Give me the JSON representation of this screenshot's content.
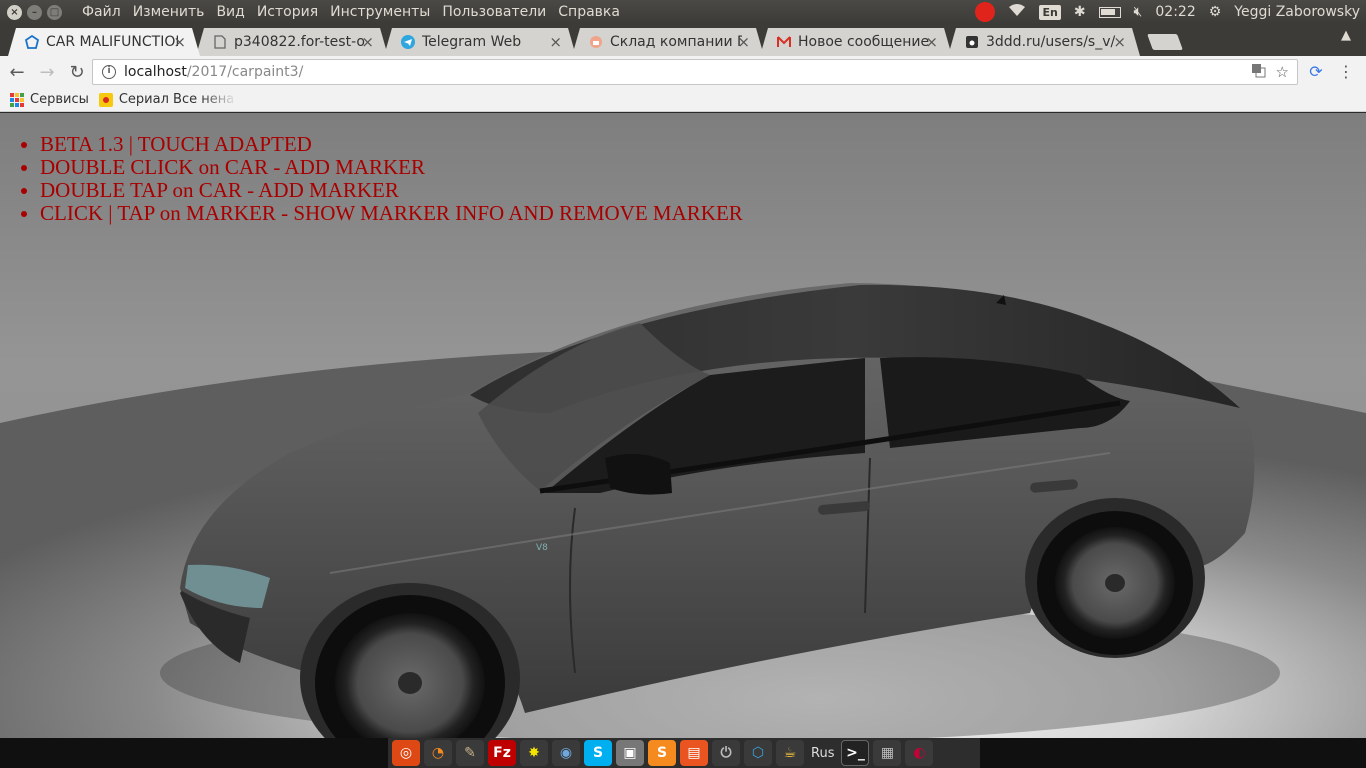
{
  "system_panel": {
    "menu": [
      "Файл",
      "Изменить",
      "Вид",
      "История",
      "Инструменты",
      "Пользователи",
      "Справка"
    ],
    "lang": "En",
    "clock": "02:22",
    "user": "Yeggi Zaborowsky"
  },
  "tabs": [
    {
      "title": "CAR MALIFUNCTIOI",
      "icon": "three-js-icon",
      "active": true
    },
    {
      "title": "p340822.for-test-on",
      "icon": "page-icon",
      "active": false
    },
    {
      "title": "Telegram Web",
      "icon": "telegram-icon",
      "active": false
    },
    {
      "title": "Склад компании Г/",
      "icon": "warehouse-icon",
      "active": false
    },
    {
      "title": "Новое сообщение",
      "icon": "gmail-icon",
      "active": false
    },
    {
      "title": "3ddd.ru/users/s_v/",
      "icon": "3ddd-icon",
      "active": false
    }
  ],
  "address": {
    "host": "localhost",
    "path": "/2017/carpaint3/"
  },
  "bookmarks": {
    "apps_label": "Сервисы",
    "item_label": "Сериал Все нена"
  },
  "page": {
    "info_items": [
      "BETA 1.3 | TOUCH ADAPTED",
      "DOUBLE CLICK on CAR - ADD MARKER",
      "DOUBLE TAP on CAR - ADD MARKER",
      "CLICK | TAP on MARKER - SHOW MARKER INFO AND REMOVE MARKER"
    ],
    "text_color": "#a80000",
    "badge": "V8"
  },
  "dock": {
    "lang_label": "Rus",
    "items": [
      "ubuntu-logo-icon",
      "blender-icon",
      "gimp-icon",
      "filezilla-icon",
      "sun-icon",
      "chromium-icon",
      "skype-icon",
      "camera-icon",
      "sublime-icon",
      "files-icon",
      "power-icon",
      "three-js-icon",
      "java-icon",
      "terminal-icon",
      "windows-icon",
      "debian-icon"
    ]
  }
}
